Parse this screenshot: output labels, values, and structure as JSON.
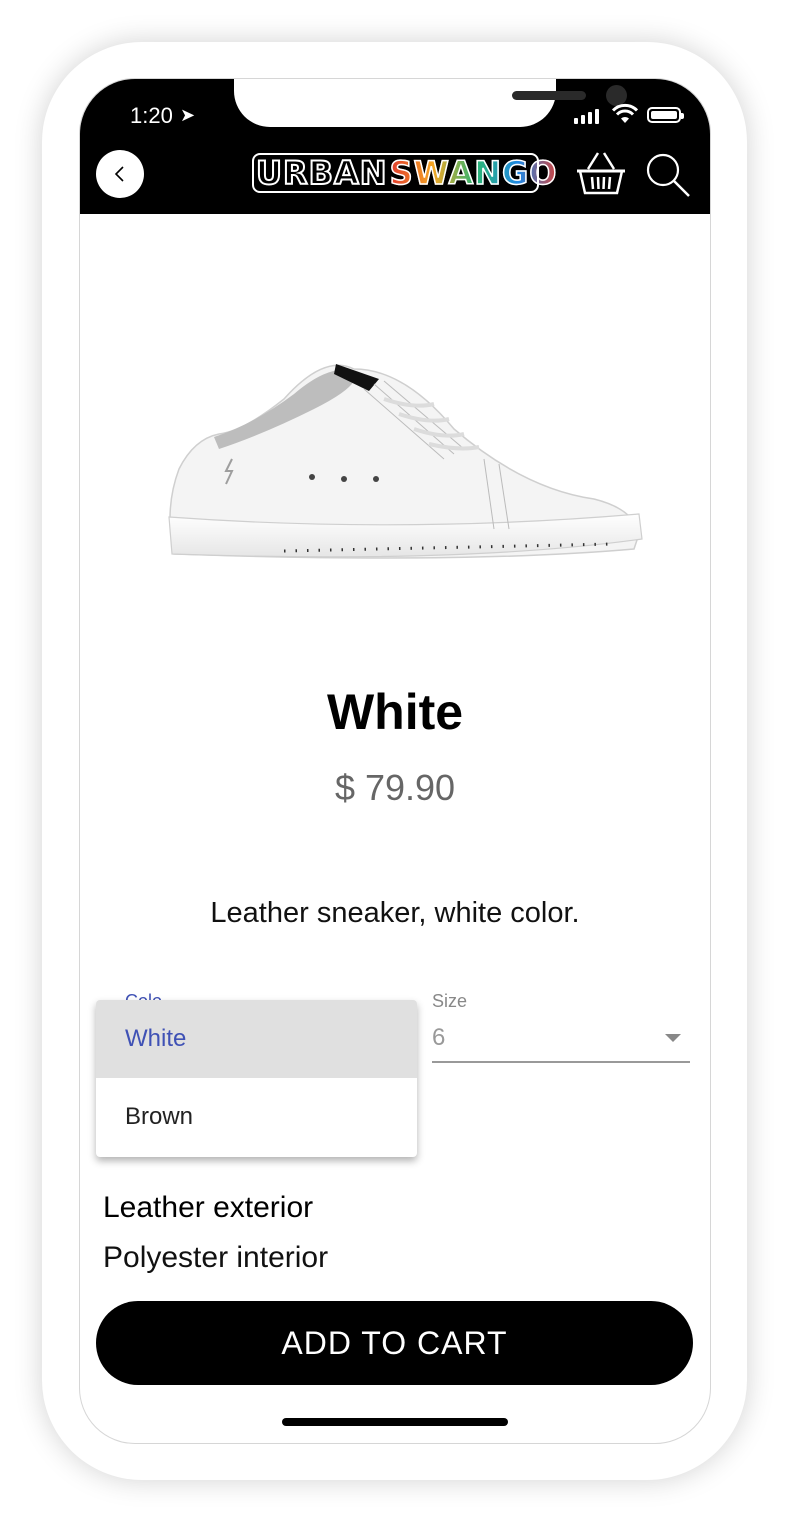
{
  "status_bar": {
    "time": "1:20"
  },
  "header": {
    "logo_left": "URBAN",
    "logo_right": "SWANGO",
    "back_icon": "chevron-left-icon",
    "cart_icon": "basket-icon",
    "search_icon": "search-icon"
  },
  "product": {
    "title": "White",
    "price": "$ 79.90",
    "description": "Leather sneaker, white color.",
    "features": [
      "Leather exterior",
      "Polyester interior"
    ]
  },
  "color_select": {
    "label": "Colo",
    "options": [
      "White",
      "Brown"
    ],
    "selected": "White",
    "accent": "#3f51b5"
  },
  "size_select": {
    "label": "Size",
    "value": "6"
  },
  "actions": {
    "add_to_cart": "ADD TO CART"
  }
}
